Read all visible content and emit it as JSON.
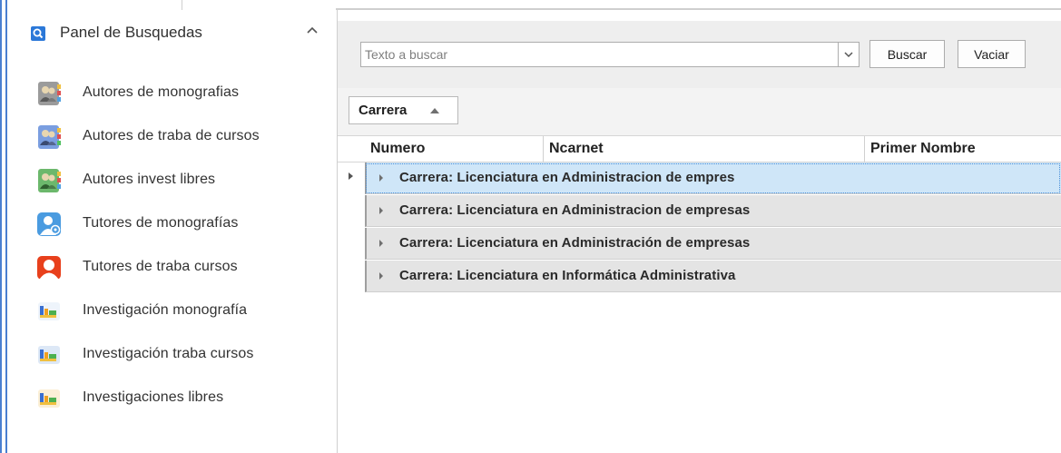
{
  "sidebar": {
    "panel_title": "Panel de Busquedas",
    "items": [
      {
        "label": "Autores de monografias",
        "icon": "contacts-book-icon"
      },
      {
        "label": "Autores de traba de cursos",
        "icon": "contacts-book-icon"
      },
      {
        "label": "Autores invest libres",
        "icon": "contacts-book-icon"
      },
      {
        "label": "Tutores de monografías",
        "icon": "user-settings-icon"
      },
      {
        "label": "Tutores de traba cursos",
        "icon": "user-icon"
      },
      {
        "label": "Investigación monografía",
        "icon": "chart-folder-icon"
      },
      {
        "label": "Investigación traba cursos",
        "icon": "chart-folder-icon"
      },
      {
        "label": "Investigaciones libres",
        "icon": "chart-folder-icon"
      }
    ]
  },
  "search": {
    "placeholder": "Texto a buscar",
    "buscar_label": "Buscar",
    "vaciar_label": "Vaciar"
  },
  "grouping": {
    "chip_label": "Carrera"
  },
  "grid": {
    "columns": [
      "Numero",
      "Ncarnet",
      "Primer Nombre"
    ],
    "groups": [
      "Carrera: Licenciatura en Administracion de empres",
      "Carrera: Licenciatura en Administracion de empresas",
      "Carrera: Licenciatura en Administración de empresas",
      "Carrera: Licenciatura en Informática Administrativa"
    ]
  },
  "colors": {
    "accent": "#2b78d8",
    "selected_row": "#cfe6f8",
    "group_row": "#e4e4e4"
  }
}
